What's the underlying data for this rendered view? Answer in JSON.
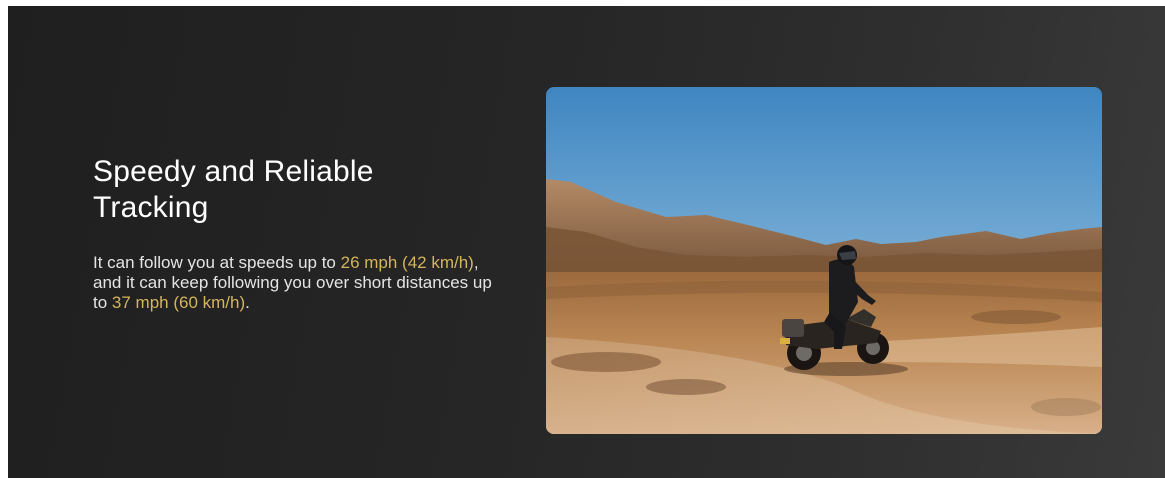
{
  "section": {
    "title_line1": "Speedy and Reliable",
    "title_line2": "Tracking",
    "description": {
      "part1": "It can follow you at speeds up to ",
      "highlight1": "26 mph (42 km/h)",
      "part2": ", and it can keep following you over short distances up to ",
      "highlight2": "37 mph (60 km/h)",
      "part3": "."
    }
  },
  "colors": {
    "background": "#262626",
    "title": "#ffffff",
    "text": "#e4e4e4",
    "highlight": "#d4b45c"
  },
  "media": {
    "icon": "motorcycle-desert-photo"
  }
}
